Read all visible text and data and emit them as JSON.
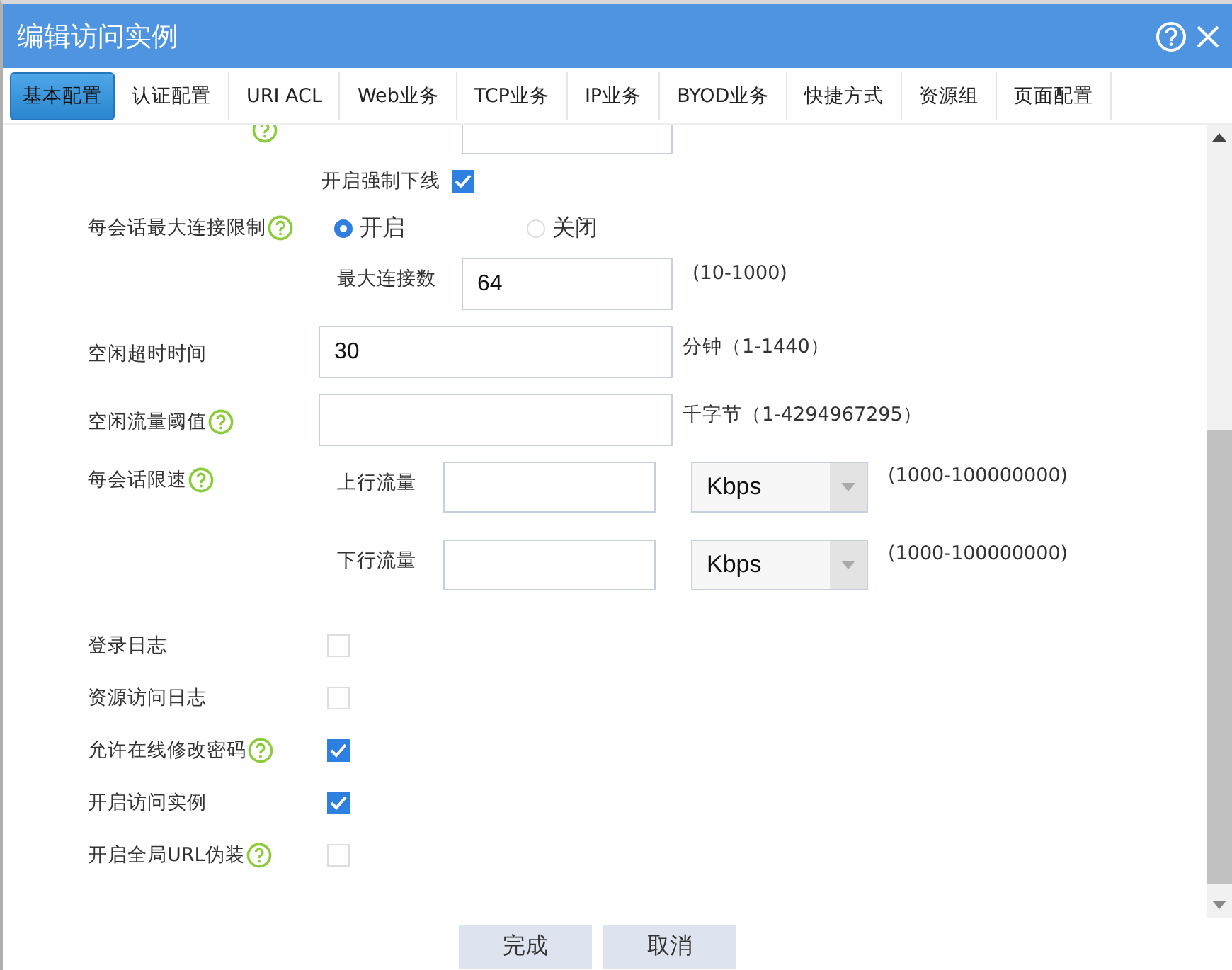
{
  "window": {
    "title": "编辑访问实例"
  },
  "tabs": [
    {
      "label": "基本配置",
      "selected": true
    },
    {
      "label": "认证配置",
      "selected": false
    },
    {
      "label": "URI ACL",
      "selected": false
    },
    {
      "label": "Web业务",
      "selected": false
    },
    {
      "label": "TCP业务",
      "selected": false
    },
    {
      "label": "IP业务",
      "selected": false
    },
    {
      "label": "BYOD业务",
      "selected": false
    },
    {
      "label": "快捷方式",
      "selected": false
    },
    {
      "label": "资源组",
      "selected": false
    },
    {
      "label": "页面配置",
      "selected": false
    }
  ],
  "rows": [
    {
      "kind": "subfield",
      "help": true
    },
    {
      "kind": "subcheck",
      "label": "开启强制下线",
      "checked": true
    },
    {
      "kind": "radio",
      "label": "每会话最大连接限制",
      "help": true,
      "options": [
        {
          "label": "开启",
          "selected": true
        },
        {
          "label": "关闭",
          "selected": false
        }
      ]
    },
    {
      "kind": "subfield",
      "sublabel": "最大连接数",
      "value": "64",
      "hint": "(10-1000)"
    },
    {
      "kind": "field",
      "label": "空闲超时时间",
      "value": "30",
      "hint": "分钟（1-1440）"
    },
    {
      "kind": "field",
      "label": "空闲流量阈值",
      "help": true,
      "hint": "千字节（1-4294967295）"
    },
    {
      "kind": "rate",
      "label": "每会话限速",
      "help": true,
      "lines": [
        {
          "label": "上行流量",
          "unit": "Kbps",
          "hint": "(1000-100000000)"
        },
        {
          "label": "下行流量",
          "unit": "Kbps",
          "hint": "(1000-100000000)"
        }
      ]
    },
    {
      "kind": "checkbox",
      "label": "登录日志",
      "checked": false
    },
    {
      "kind": "checkbox",
      "label": "资源访问日志",
      "checked": false
    },
    {
      "kind": "checkbox",
      "label": "允许在线修改密码",
      "help": true,
      "checked": true
    },
    {
      "kind": "checkbox",
      "label": "开启访问实例",
      "checked": true
    },
    {
      "kind": "checkbox",
      "label": "开启全局URL伪装",
      "help": true,
      "checked": false
    }
  ],
  "buttons": [
    "完成",
    "取消"
  ]
}
